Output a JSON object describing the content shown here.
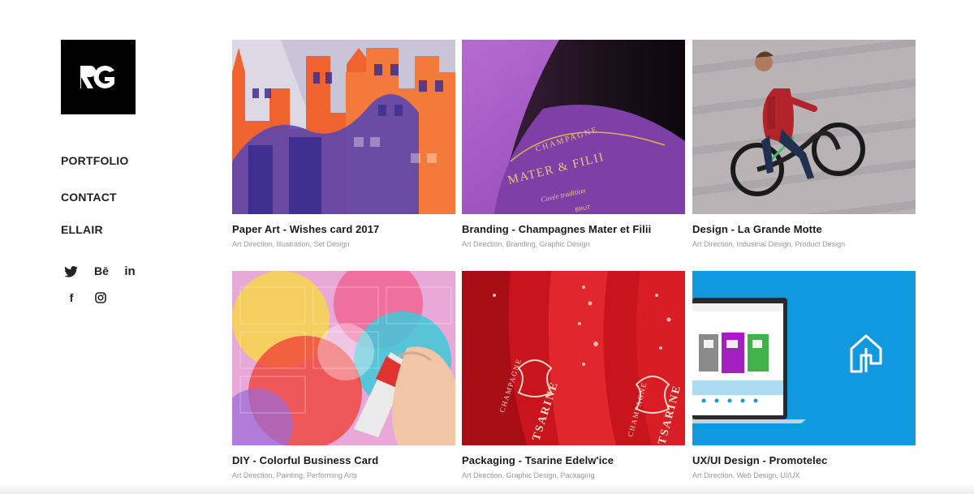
{
  "brand": {
    "logo_text": "RG"
  },
  "nav": {
    "items": [
      {
        "label": "PORTFOLIO"
      },
      {
        "label": "CONTACT"
      },
      {
        "label": "ELLAIR"
      }
    ]
  },
  "social": {
    "icons": [
      "twitter-icon",
      "behance-icon",
      "linkedin-icon",
      "facebook-icon",
      "instagram-icon"
    ],
    "behance_label": "Bē",
    "linkedin_label": "in",
    "facebook_label": "f"
  },
  "projects": [
    {
      "title": "Paper Art - Wishes card 2017",
      "tags": "Art Direction, Illustration, Set Design"
    },
    {
      "title": "Branding - Champagnes Mater et Filii",
      "tags": "Art Direction, Branding, Graphic Design"
    },
    {
      "title": "Design - La Grande Motte",
      "tags": "Art Direction, Industrial Design, Product Design"
    },
    {
      "title": "DIY - Colorful Business Card",
      "tags": "Art Direction, Painting, Performing Arts"
    },
    {
      "title": "Packaging - Tsarine Edelw'ice",
      "tags": "Art Direction, Graphic Design, Packaging"
    },
    {
      "title": "UX/UI Design - Promotelec",
      "tags": "Art Direction, Web Design, UI/UX"
    }
  ],
  "image_text": {
    "champagne_label": "CHAMPAGNE",
    "champagne_brand": "MATER & FILII",
    "champagne_sub": "Cuvée tradition",
    "champagne_brut": "BRUT",
    "tsarine_label": "CHAMPAGNE",
    "tsarine_brand": "TSARINE"
  },
  "colors": {
    "accent_orange": "#f0622e",
    "accent_purple": "#7b3fa8",
    "champagne_red": "#d8202a",
    "promotelec_blue": "#1199e0"
  }
}
